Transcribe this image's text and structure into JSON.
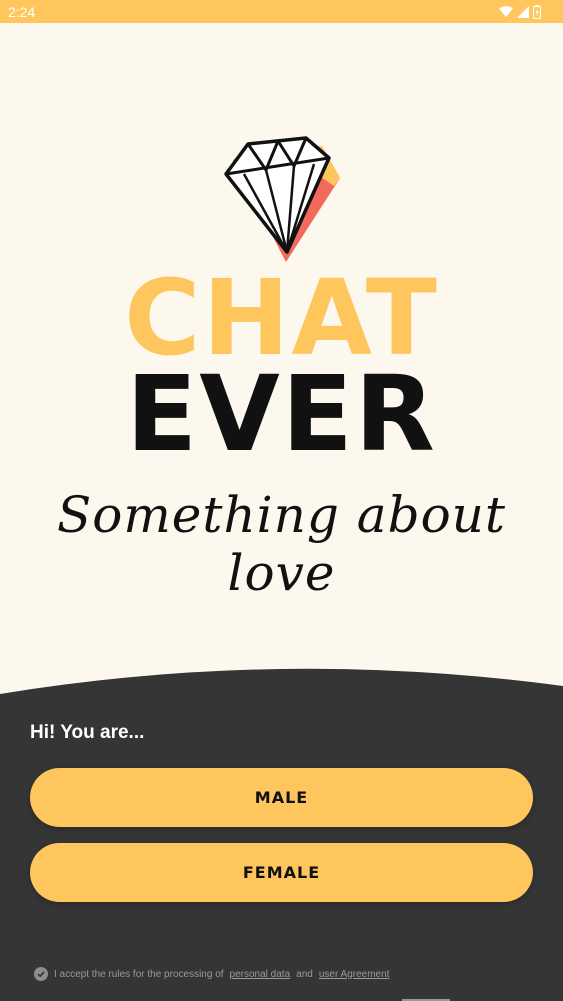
{
  "status_bar": {
    "time": "2:24"
  },
  "logo": {
    "title_top": "CHAT",
    "title_bottom": "EVER",
    "tagline": "Something about love",
    "icon": "diamond-icon"
  },
  "bottom_panel": {
    "greeting": "Hi! You are...",
    "male_label": "MALE",
    "female_label": "FEMALE",
    "consent": {
      "prefix": "I accept the rules for the processing of",
      "link1": "personal data",
      "middle": "and",
      "link2": "user Agreement"
    }
  },
  "colors": {
    "accent": "#fec65c",
    "dark": "#353535",
    "background": "#fdf8ee"
  }
}
